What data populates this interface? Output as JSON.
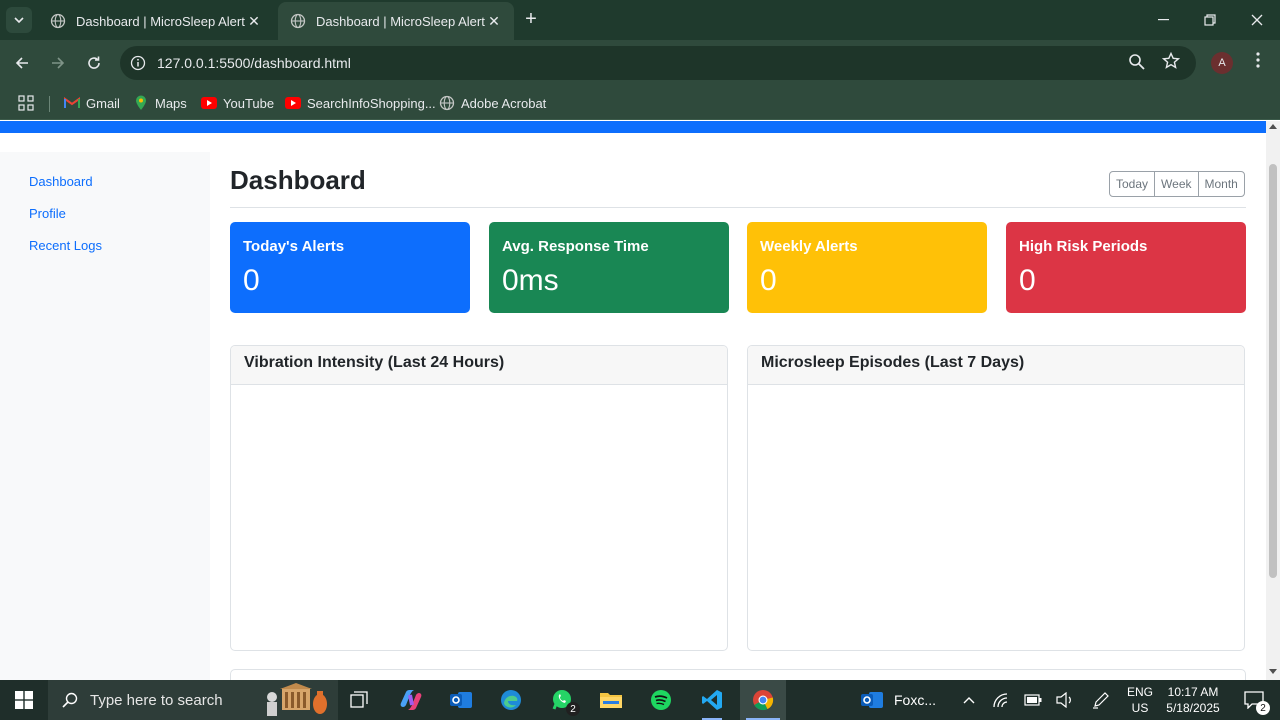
{
  "browser": {
    "tabs": [
      {
        "title": "Dashboard | MicroSleep Alert",
        "active": false
      },
      {
        "title": "Dashboard | MicroSleep Alert",
        "active": true
      }
    ],
    "url": "127.0.0.1:5500/dashboard.html",
    "profile_initial": "A",
    "bookmarks": [
      {
        "label": "Gmail",
        "icon": "gmail-icon"
      },
      {
        "label": "Maps",
        "icon": "maps-icon"
      },
      {
        "label": "YouTube",
        "icon": "youtube-icon"
      },
      {
        "label": "SearchInfoShopping...",
        "icon": "youtube-icon"
      },
      {
        "label": "Adobe Acrobat",
        "icon": "globe-icon"
      }
    ]
  },
  "sidebar": {
    "items": [
      {
        "label": "Dashboard"
      },
      {
        "label": "Profile"
      },
      {
        "label": "Recent Logs"
      }
    ]
  },
  "main": {
    "title": "Dashboard",
    "range_buttons": [
      "Today",
      "Week",
      "Month"
    ],
    "stats": [
      {
        "label": "Today's Alerts",
        "value": "0",
        "color": "#0d6efd"
      },
      {
        "label": "Avg. Response Time",
        "value": "0ms",
        "color": "#198754"
      },
      {
        "label": "Weekly Alerts",
        "value": "0",
        "color": "#ffc107"
      },
      {
        "label": "High Risk Periods",
        "value": "0",
        "color": "#dc3545"
      }
    ],
    "charts": [
      {
        "title": "Vibration Intensity (Last 24 Hours)"
      },
      {
        "title": "Microsleep Episodes (Last 7 Days)"
      }
    ]
  },
  "taskbar": {
    "search_placeholder": "Type here to search",
    "whatsapp_badge": "2",
    "outlook_label": "Foxc...",
    "lang": "ENG",
    "region": "US",
    "time": "10:17 AM",
    "date": "5/18/2025",
    "notification_count": "2"
  }
}
